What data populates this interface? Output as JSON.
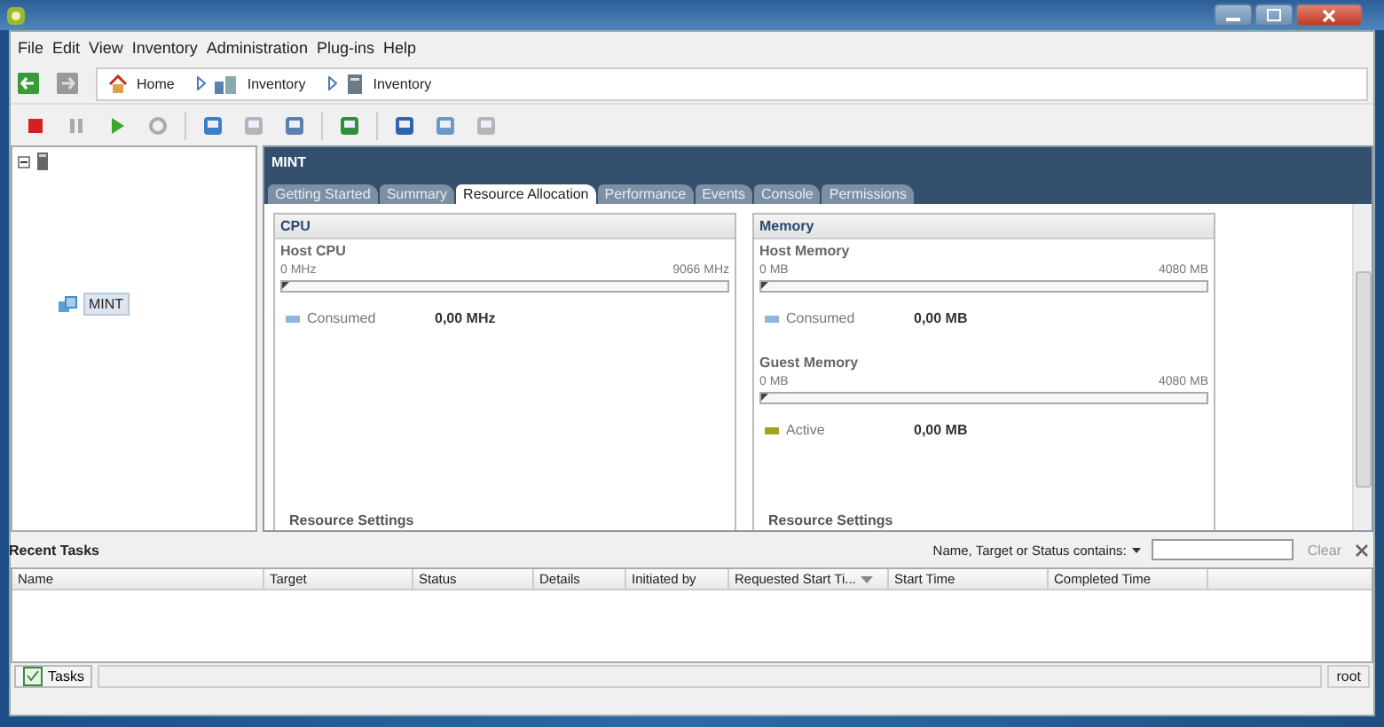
{
  "menu": [
    "File",
    "Edit",
    "View",
    "Inventory",
    "Administration",
    "Plug-ins",
    "Help"
  ],
  "breadcrumb": [
    {
      "label": "Home",
      "kind": "home"
    },
    {
      "label": "Inventory",
      "kind": "hosts"
    },
    {
      "label": "Inventory",
      "kind": "vm"
    }
  ],
  "toolbar": [
    {
      "kind": "stop",
      "disabled": false
    },
    {
      "kind": "pause",
      "disabled": true
    },
    {
      "kind": "play",
      "disabled": false
    },
    {
      "kind": "reset",
      "disabled": true
    },
    {
      "kind": "snapshot",
      "disabled": false
    },
    {
      "kind": "revert",
      "disabled": true
    },
    {
      "kind": "manager",
      "disabled": false
    },
    {
      "kind": "console",
      "disabled": false
    },
    {
      "kind": "migrate",
      "disabled": false
    },
    {
      "kind": "clone",
      "disabled": false
    },
    {
      "kind": "settings",
      "disabled": true
    }
  ],
  "tree": {
    "expanded": true,
    "children": [
      {
        "label": "MINT",
        "selected": true
      }
    ]
  },
  "detail": {
    "title": "MINT",
    "tabs": [
      {
        "label": "Getting Started",
        "selected": false
      },
      {
        "label": "Summary",
        "selected": false
      },
      {
        "label": "Resource Allocation",
        "selected": true
      },
      {
        "label": "Performance",
        "selected": false
      },
      {
        "label": "Events",
        "selected": false
      },
      {
        "label": "Console",
        "selected": false
      },
      {
        "label": "Permissions",
        "selected": false
      }
    ],
    "panels": [
      {
        "title": "CPU",
        "sections": [
          {
            "title": "Host CPU",
            "min": "0 MHz",
            "max": "9066 MHz",
            "level": 0,
            "legend": [
              {
                "label": "Consumed",
                "value": "0,00 MHz",
                "color": "#8fb6e0"
              }
            ]
          }
        ],
        "footer": "Resource Settings"
      },
      {
        "title": "Memory",
        "sections": [
          {
            "title": "Host Memory",
            "min": "0 MB",
            "max": "4080 MB",
            "level": 0,
            "legend": [
              {
                "label": "Consumed",
                "value": "0,00 MB",
                "color": "#8fb6e0"
              }
            ]
          },
          {
            "title": "Guest Memory",
            "min": "0 MB",
            "max": "4080 MB",
            "level": 0,
            "legend": [
              {
                "label": "Active",
                "value": "0,00 MB",
                "color": "#a3a318"
              }
            ]
          }
        ],
        "footer": "Resource Settings"
      }
    ]
  },
  "recent_tasks": {
    "title": "Recent Tasks",
    "filter_label": "Name, Target or Status contains:",
    "clear": "Clear",
    "columns": [
      {
        "label": "Name",
        "sorted": false
      },
      {
        "label": "Target",
        "sorted": false
      },
      {
        "label": "Status",
        "sorted": false
      },
      {
        "label": "Details",
        "sorted": false
      },
      {
        "label": "Initiated by",
        "sorted": false
      },
      {
        "label": "Requested Start Ti...",
        "sorted": true
      },
      {
        "label": "Start Time",
        "sorted": false
      },
      {
        "label": "Completed Time",
        "sorted": false
      }
    ]
  },
  "status_bar": {
    "tasks": "Tasks",
    "user": "root"
  }
}
